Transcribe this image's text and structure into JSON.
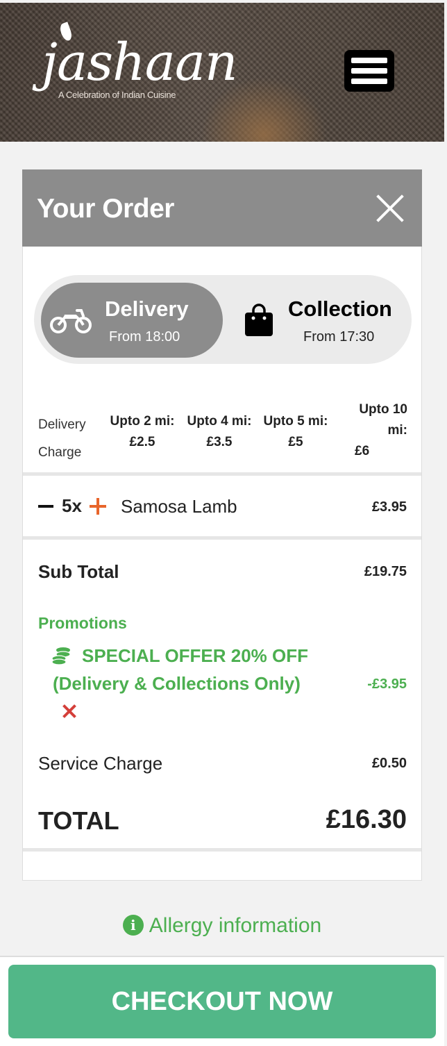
{
  "header": {
    "logo_word": "jashaan",
    "logo_tagline": "A Celebration of Indian Cuisine"
  },
  "order": {
    "title": "Your Order",
    "modes": {
      "delivery": {
        "label": "Delivery",
        "time": "From 18:00",
        "selected": true
      },
      "collection": {
        "label": "Collection",
        "time": "From 17:30",
        "selected": false
      }
    },
    "delivery_charge": {
      "label_line1": "Delivery",
      "label_line2": "Charge",
      "tiers": [
        {
          "distance": "Upto 2 mi:",
          "price": "£2.5"
        },
        {
          "distance": "Upto 4 mi:",
          "price": "£3.5"
        },
        {
          "distance": "Upto 5 mi:",
          "price": "£5"
        },
        {
          "distance_line1": "Upto 10",
          "distance_line2": "mi:",
          "price": "£6"
        }
      ]
    },
    "items": [
      {
        "qty": "5x",
        "name": "Samosa Lamb",
        "price": "£3.95"
      }
    ],
    "summary": {
      "subtotal_label": "Sub Total",
      "subtotal": "£19.75",
      "promotions_label": "Promotions",
      "promo_text": "SPECIAL OFFER 20% OFF (Delivery & Collections Only)",
      "promo_amount": "-£3.95",
      "service_label": "Service Charge",
      "service": "£0.50",
      "total_label": "TOTAL",
      "total": "£16.30"
    }
  },
  "allergy_label": "Allergy information",
  "checkout_label": "CHECKOUT NOW",
  "colors": {
    "panel_header": "#8c8c8c",
    "promo_green": "#4caf50",
    "checkout_green": "#52b788",
    "plus_orange": "#e8652b",
    "remove_red": "#d43f3a"
  }
}
